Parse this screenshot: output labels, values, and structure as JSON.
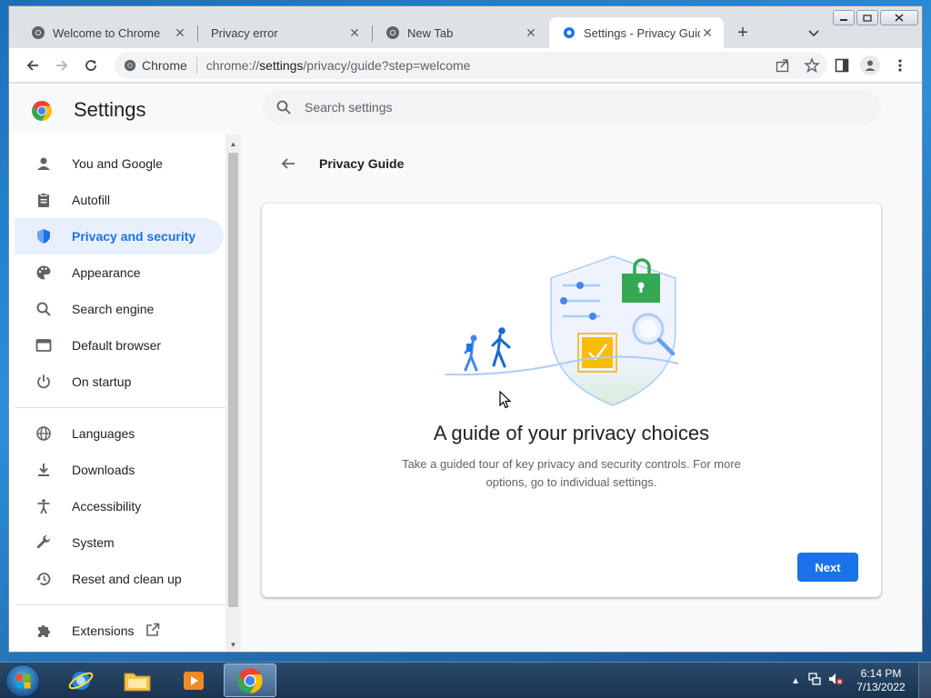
{
  "browser": {
    "tabs": [
      {
        "title": "Welcome to Chrome",
        "icon": "chrome-icon"
      },
      {
        "title": "Privacy error",
        "icon": ""
      },
      {
        "title": "New Tab",
        "icon": "chrome-icon"
      },
      {
        "title": "Settings - Privacy Guide",
        "icon": "gear-icon",
        "active": true
      }
    ],
    "omnibox": {
      "chip_label": "Chrome",
      "url_prefix": "chrome://",
      "url_host": "settings",
      "url_path": "/privacy/guide?step=welcome"
    }
  },
  "settings": {
    "title": "Settings",
    "search_placeholder": "Search settings",
    "nav": [
      {
        "label": "You and Google",
        "icon": "person-icon"
      },
      {
        "label": "Autofill",
        "icon": "clipboard-icon"
      },
      {
        "label": "Privacy and security",
        "icon": "shield-icon",
        "selected": true
      },
      {
        "label": "Appearance",
        "icon": "palette-icon"
      },
      {
        "label": "Search engine",
        "icon": "search-icon"
      },
      {
        "label": "Default browser",
        "icon": "browser-icon"
      },
      {
        "label": "On startup",
        "icon": "power-icon"
      },
      {
        "label": "Languages",
        "icon": "globe-icon"
      },
      {
        "label": "Downloads",
        "icon": "download-icon"
      },
      {
        "label": "Accessibility",
        "icon": "accessibility-icon"
      },
      {
        "label": "System",
        "icon": "wrench-icon"
      },
      {
        "label": "Reset and clean up",
        "icon": "history-icon"
      },
      {
        "label": "Extensions",
        "icon": "puzzle-icon"
      }
    ]
  },
  "privacy_guide": {
    "header": "Privacy Guide",
    "card_title": "A guide of your privacy choices",
    "card_desc": "Take a guided tour of key privacy and security controls. For more options, go to individual settings.",
    "next_label": "Next"
  },
  "taskbar": {
    "time": "6:14 PM",
    "date": "7/13/2022"
  },
  "colors": {
    "accent": "#1a73e8",
    "selected_bg": "#e8f0fe"
  }
}
